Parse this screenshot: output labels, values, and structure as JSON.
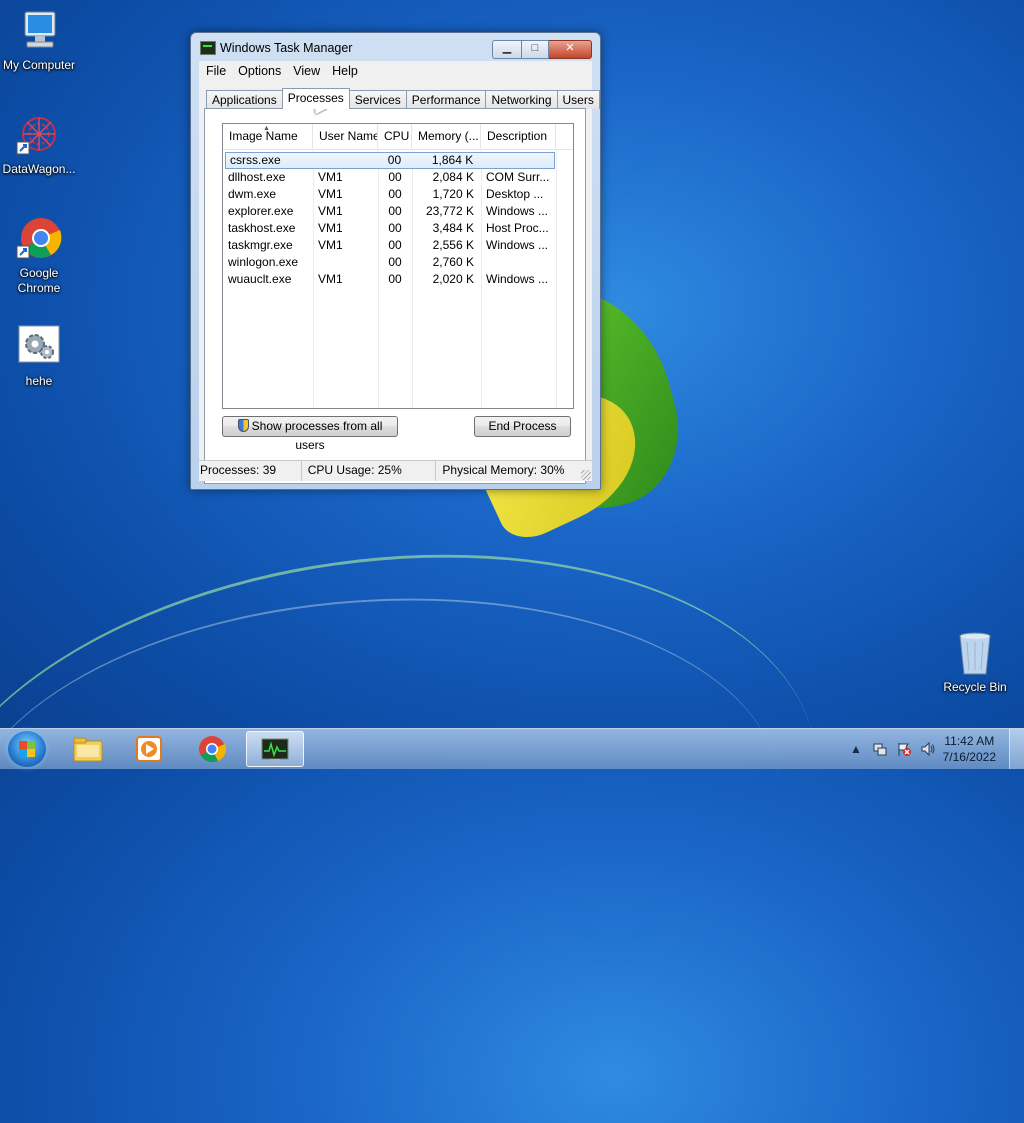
{
  "desktop": {
    "icons": [
      {
        "label": "My Computer",
        "icon": "computer-icon"
      },
      {
        "label": "DataWagon...",
        "icon": "datawagon-icon"
      },
      {
        "label": "Google Chrome",
        "icon": "chrome-icon"
      },
      {
        "label": "hehe",
        "icon": "settings-file-icon"
      },
      {
        "label": "Recycle Bin",
        "icon": "recycle-bin-icon"
      }
    ]
  },
  "window": {
    "title": "Windows Task Manager",
    "controls": {
      "minimize": "▁",
      "maximize": "□",
      "close": "✕"
    }
  },
  "menu": [
    "File",
    "Options",
    "View",
    "Help"
  ],
  "tabs": [
    "Applications",
    "Processes",
    "Services",
    "Performance",
    "Networking",
    "Users"
  ],
  "active_tab": "Processes",
  "processes": {
    "columns": [
      "Image Name",
      "User Name",
      "CPU",
      "Memory (...",
      "Description"
    ],
    "rows": [
      {
        "name": "csrss.exe",
        "user": "",
        "cpu": "00",
        "mem": "1,864 K",
        "desc": ""
      },
      {
        "name": "dllhost.exe",
        "user": "VM1",
        "cpu": "00",
        "mem": "2,084 K",
        "desc": "COM Surr..."
      },
      {
        "name": "dwm.exe",
        "user": "VM1",
        "cpu": "00",
        "mem": "1,720 K",
        "desc": "Desktop ..."
      },
      {
        "name": "explorer.exe",
        "user": "VM1",
        "cpu": "00",
        "mem": "23,772 K",
        "desc": "Windows ..."
      },
      {
        "name": "taskhost.exe",
        "user": "VM1",
        "cpu": "00",
        "mem": "3,484 K",
        "desc": "Host Proc..."
      },
      {
        "name": "taskmgr.exe",
        "user": "VM1",
        "cpu": "00",
        "mem": "2,556 K",
        "desc": "Windows ..."
      },
      {
        "name": "winlogon.exe",
        "user": "",
        "cpu": "00",
        "mem": "2,760 K",
        "desc": ""
      },
      {
        "name": "wuauclt.exe",
        "user": "VM1",
        "cpu": "00",
        "mem": "2,020 K",
        "desc": "Windows ..."
      }
    ],
    "selected_row": 0,
    "show_all_label": "Show processes from all users",
    "end_process_label": "End Process"
  },
  "status": {
    "processes": "Processes: 39",
    "cpu": "CPU Usage: 25%",
    "memory": "Physical Memory: 30%"
  },
  "taskbar": {
    "items": [
      "explorer-icon",
      "media-player-icon",
      "chrome-icon",
      "task-manager-icon"
    ],
    "active_item": "task-manager-icon",
    "clock_time": "11:42 AM",
    "clock_date": "7/16/2022"
  },
  "colors": {
    "accent": "#3b84d6",
    "selection": "#dcebfc",
    "close": "#c4452b"
  }
}
